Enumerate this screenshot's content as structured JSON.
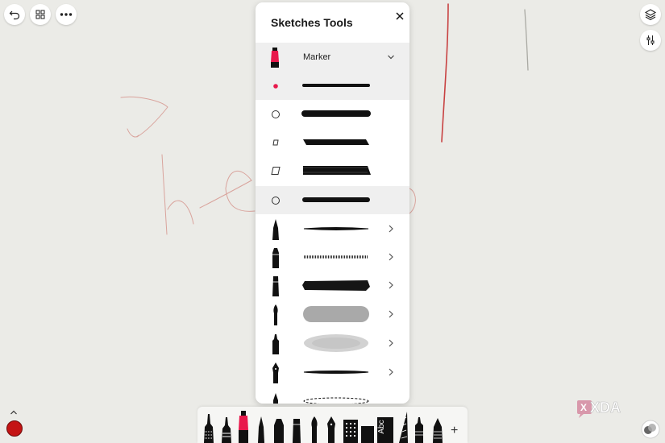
{
  "panel": {
    "title": "Sketches Tools",
    "selected_tool_label": "Marker"
  },
  "bottom_toolbar": {
    "add_label": "+",
    "text_tool_label": "Abc"
  },
  "watermark": {
    "text": "XDA"
  },
  "colors": {
    "accent": "#e8194c",
    "current_brush_color": "#c41414",
    "canvas": "#ebebe7"
  },
  "icons": {
    "top_left": [
      "undo-icon",
      "gallery-grid-icon",
      "more-icon"
    ],
    "top_right": [
      "layers-icon",
      "adjustments-icon"
    ]
  }
}
